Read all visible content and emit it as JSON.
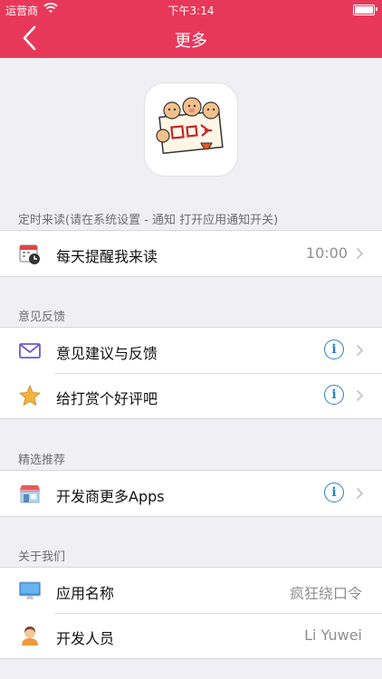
{
  "status_bar": {
    "carrier": "运营商",
    "time": "下午3:14"
  },
  "nav": {
    "title": "更多"
  },
  "sections": {
    "reminder": {
      "header": "定时来读(请在系统设置 - 通知 打开应用通知开关)",
      "items": [
        {
          "label": "每天提醒我来读",
          "value": "10:00",
          "icon": "calendar-clock-icon"
        }
      ]
    },
    "feedback": {
      "header": "意见反馈",
      "items": [
        {
          "label": "意见建议与反馈",
          "icon": "mail-icon"
        },
        {
          "label": "给打赏个好评吧",
          "icon": "star-icon"
        }
      ]
    },
    "recommend": {
      "header": "精选推荐",
      "items": [
        {
          "label": "开发商更多Apps",
          "icon": "store-icon"
        }
      ]
    },
    "about": {
      "header": "关于我们",
      "items": [
        {
          "label": "应用名称",
          "value": "疯狂绕口令",
          "icon": "computer-icon"
        },
        {
          "label": "开发人员",
          "value": "Li Yuwei",
          "icon": "person-icon"
        }
      ]
    }
  },
  "colors": {
    "accent": "#e8385a",
    "info": "#2a7fd4"
  },
  "info_glyph": "i"
}
